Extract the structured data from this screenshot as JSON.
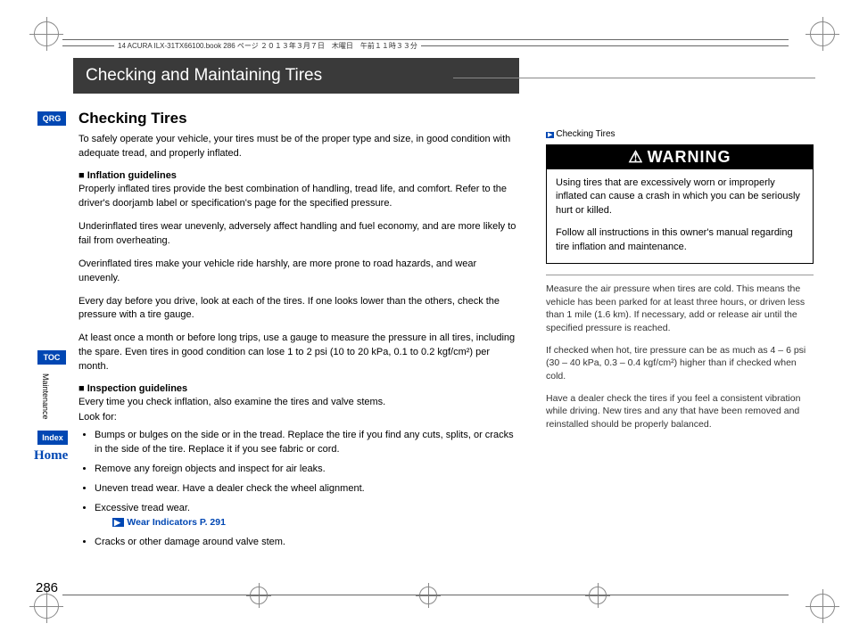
{
  "header_text": "14 ACURA ILX-31TX66100.book  286 ページ  ２０１３年３月７日　木曜日　午前１１時３３分",
  "section_title": "Checking and Maintaining Tires",
  "sub_title": "Checking Tires",
  "intro": "To safely operate your vehicle, your tires must be of the proper type and size, in good condition with adequate tread, and properly inflated.",
  "inflation": {
    "heading": "Inflation guidelines",
    "p1": "Properly inflated tires provide the best combination of handling, tread life, and comfort. Refer to the driver's doorjamb label or specification's page for the specified pressure.",
    "p2": "Underinflated tires wear unevenly, adversely affect handling and fuel economy, and are more likely to fail from overheating.",
    "p3": "Overinflated tires make your vehicle ride harshly, are more prone to road hazards, and wear unevenly.",
    "p4": "Every day before you drive, look at each of the tires. If one looks lower than the others, check the pressure with a tire gauge.",
    "p5": "At least once a month or before long trips, use a gauge to measure the pressure in all tires, including the spare. Even tires in good condition can lose 1 to 2 psi (10 to 20 kPa, 0.1 to 0.2 kgf/cm²) per month."
  },
  "inspection": {
    "heading": "Inspection guidelines",
    "intro1": "Every time you check inflation, also examine the tires and valve stems.",
    "intro2": "Look for:",
    "items": [
      "Bumps or bulges on the side or in the tread. Replace the tire if you find any cuts, splits, or cracks in the side of the tire. Replace it if you see fabric or cord.",
      "Remove any foreign objects and inspect for air leaks.",
      "Uneven tread wear. Have a dealer check the wheel alignment.",
      "Excessive tread wear.",
      "Cracks or other damage around valve stem."
    ],
    "xref": "Wear Indicators P. 291"
  },
  "page_number": "286",
  "tabs": {
    "qrg": "QRG",
    "toc": "TOC",
    "index": "Index",
    "section": "Maintenance",
    "home": "Home"
  },
  "right": {
    "crossref": "Checking Tires",
    "warning_title": "WARNING",
    "warning_p1": "Using tires that are excessively worn or improperly inflated can cause a crash in which you can be seriously hurt or killed.",
    "warning_p2": "Follow all instructions in this owner's manual regarding tire inflation and maintenance.",
    "note_p1": "Measure the air pressure when tires are cold. This means the vehicle has been parked for at least three hours, or driven less than 1 mile (1.6 km). If necessary, add or release air until the specified pressure is reached.",
    "note_p2": "If checked when hot, tire pressure can be as much as 4 – 6 psi (30 – 40 kPa, 0.3 – 0.4 kgf/cm²) higher than if checked when cold.",
    "note_p3": "Have a dealer check the tires if you feel a consistent vibration while driving. New tires and any that have been removed and reinstalled should be properly balanced."
  }
}
